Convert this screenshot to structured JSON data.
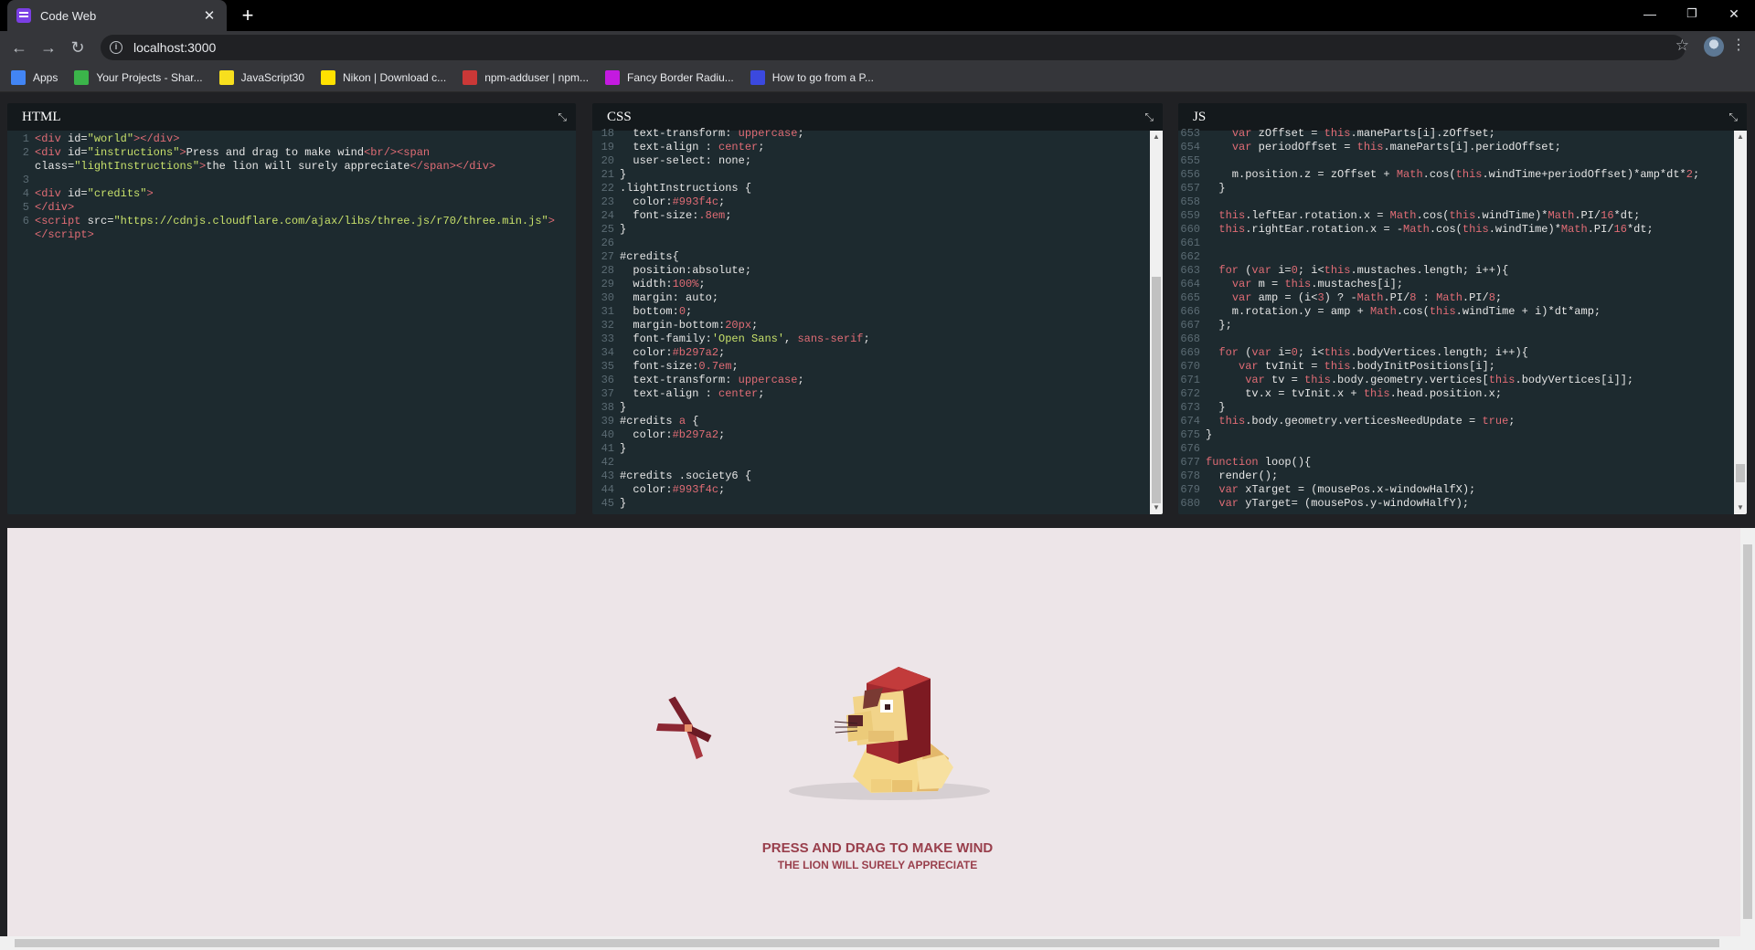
{
  "browser": {
    "tab_title": "Code Web",
    "url": "localhost:3000",
    "bookmarks": [
      {
        "label": "Apps",
        "icon": "apps-grid-icon",
        "color": "#4285f4"
      },
      {
        "label": "Your Projects - Shar...",
        "icon": "leaf-icon",
        "color": "#3bb54a"
      },
      {
        "label": "JavaScript30",
        "icon": "js-icon",
        "color": "#f7df1e"
      },
      {
        "label": "Nikon | Download c...",
        "icon": "nikon-icon",
        "color": "#ffe100"
      },
      {
        "label": "npm-adduser | npm...",
        "icon": "npm-icon",
        "color": "#cb3837"
      },
      {
        "label": "Fancy Border Radiu...",
        "icon": "blob-icon",
        "color": "#c41ae0"
      },
      {
        "label": "How to go from a P...",
        "icon": "dev-icon",
        "color": "#3b49df"
      }
    ]
  },
  "panes": {
    "html": {
      "title": "HTML"
    },
    "css": {
      "title": "CSS"
    },
    "js": {
      "title": "JS"
    }
  },
  "preview": {
    "instruction": "PRESS AND DRAG TO MAKE WIND",
    "light_instruction": "THE LION WILL SURELY APPRECIATE"
  },
  "colors": {
    "instruction": "#993f4c",
    "light_instruction": "#993f4c",
    "background": "#ede5e8"
  }
}
